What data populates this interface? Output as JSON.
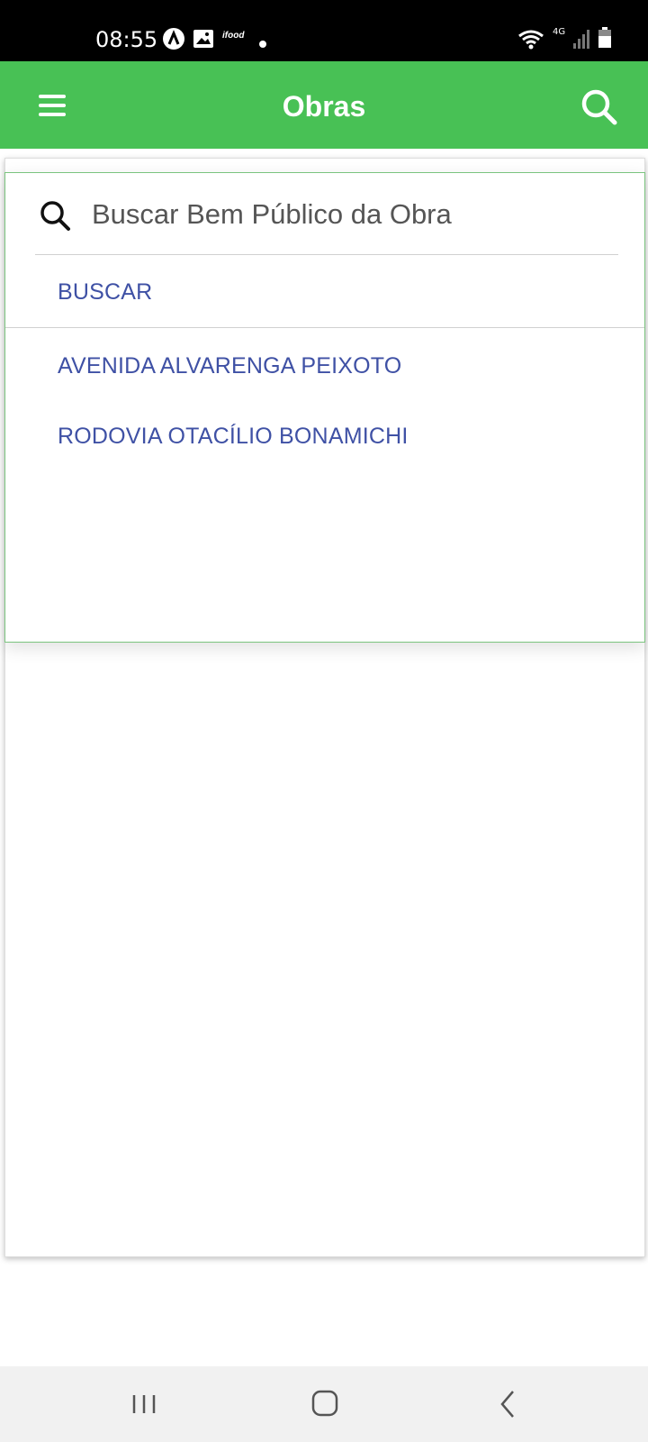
{
  "status_bar": {
    "time": "08:55",
    "left_icons": [
      "app-a-icon",
      "image-icon",
      "ifood-icon",
      "dot-icon"
    ],
    "ifood_text": "ifood",
    "network_label": "4G",
    "right_icons": [
      "wifi-icon",
      "signal-icon",
      "battery-icon"
    ]
  },
  "app_bar": {
    "title": "Obras",
    "menu_icon": "menu-icon",
    "search_icon": "search-icon",
    "background_color": "#48c155"
  },
  "search": {
    "placeholder": "Buscar Bem Público da Obra",
    "value": ""
  },
  "results": {
    "action_label": "BUSCAR",
    "items": [
      {
        "label": "AVENIDA ALVARENGA PEIXOTO"
      },
      {
        "label": "RODOVIA OTACÍLIO BONAMICHI"
      }
    ],
    "text_color": "#3f51a5"
  },
  "nav_bar": {
    "buttons": [
      "recent-apps-icon",
      "home-icon",
      "back-icon"
    ]
  }
}
